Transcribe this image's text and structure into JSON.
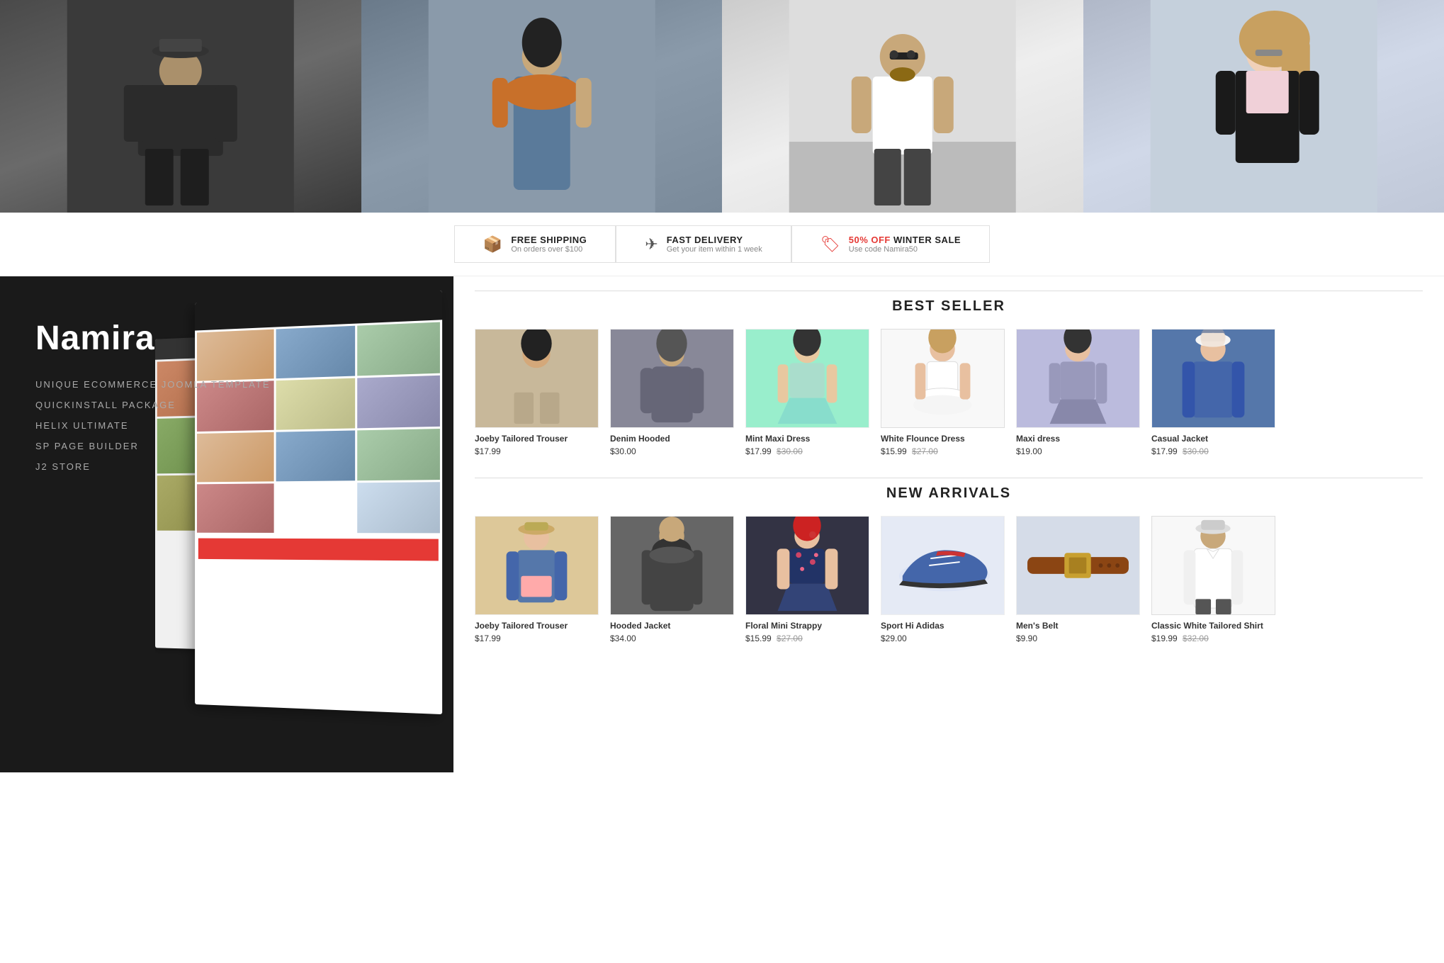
{
  "hero": {
    "images": [
      {
        "id": "hero-1",
        "alt": "Man in casual outfit",
        "class": "pimg-man1"
      },
      {
        "id": "hero-2",
        "alt": "Woman in denim dress",
        "class": "pimg-woman1"
      },
      {
        "id": "hero-3",
        "alt": "Man in white t-shirt",
        "class": "pimg-man2"
      },
      {
        "id": "hero-4",
        "alt": "Woman in jacket",
        "class": "pimg-woman2"
      }
    ],
    "dots": [
      "active",
      "",
      "",
      ""
    ]
  },
  "info_bar": {
    "items": [
      {
        "icon": "📦",
        "title": "FREE SHIPPING",
        "subtitle": "On orders over $100"
      },
      {
        "icon": "✈",
        "title": "FAST DELIVERY",
        "subtitle": "Get your item within 1 week"
      },
      {
        "icon": "🏷",
        "title_prefix": "50% OFF",
        "title_suffix": " WINTER SALE",
        "subtitle": "Use code Namira50",
        "highlight": true
      }
    ]
  },
  "promo": {
    "title": "Namira",
    "features": [
      "UNIQUE ECOMMERCE JOOMLA TEMPLATE",
      "QUICKINSTALL PACKAGE",
      "HELIX ULTIMATE",
      "SP PAGE BUILDER",
      "J2 STORE"
    ]
  },
  "best_seller": {
    "section_title": "BEST SELLER",
    "products": [
      {
        "name": "Joeby Tailored Trouser",
        "price": "$17.99",
        "old_price": "",
        "img_class": "pimg-1"
      },
      {
        "name": "Denim Hooded",
        "price": "$30.00",
        "old_price": "",
        "img_class": "pimg-2"
      },
      {
        "name": "Mint Maxi Dress",
        "price": "$17.99",
        "old_price": "$30.00",
        "img_class": "pimg-3"
      },
      {
        "name": "White Flounce Dress",
        "price": "$15.99",
        "old_price": "$27.00",
        "img_class": "pimg-4"
      },
      {
        "name": "Maxi dress",
        "price": "$19.00",
        "old_price": "",
        "img_class": "pimg-5"
      },
      {
        "name": "Casual Jacket",
        "price": "$17.99",
        "old_price": "$30.00",
        "img_class": "pimg-6"
      }
    ]
  },
  "new_arrivals": {
    "section_title": "NEW ARRIVALS",
    "products": [
      {
        "name": "Joeby Tailored Trouser",
        "price": "$17.99",
        "old_price": "",
        "img_class": "pimg-n1"
      },
      {
        "name": "Hooded Jacket",
        "price": "$34.00",
        "old_price": "",
        "img_class": "pimg-n2"
      },
      {
        "name": "Floral Mini Strappy",
        "price": "$15.99",
        "old_price": "$27.00",
        "img_class": "pimg-n3"
      },
      {
        "name": "Sport Hi Adidas",
        "price": "$29.00",
        "old_price": "",
        "img_class": "pimg-n4"
      },
      {
        "name": "Men's Belt",
        "price": "$9.90",
        "old_price": "",
        "img_class": "pimg-n5"
      },
      {
        "name": "Classic White Tailored Shirt",
        "price": "$19.99",
        "old_price": "$32.00",
        "img_class": "pimg-n6"
      }
    ]
  }
}
